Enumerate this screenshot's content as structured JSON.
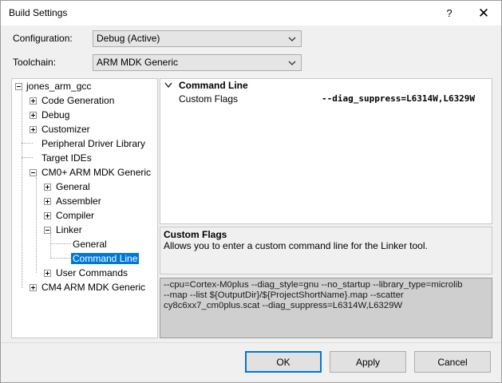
{
  "window": {
    "title": "Build Settings",
    "help_glyph": "?",
    "close_glyph": "✕"
  },
  "configuration": {
    "label": "Configuration:",
    "value": "Debug (Active)"
  },
  "toolchain": {
    "label": "Toolchain:",
    "value": "ARM MDK Generic"
  },
  "tree": {
    "root": "jones_arm_gcc",
    "items": [
      "Code Generation",
      "Debug",
      "Customizer",
      "Peripheral Driver Library",
      "Target IDEs",
      "CM0+ ARM MDK Generic",
      "General",
      "Assembler",
      "Compiler",
      "Linker",
      "General",
      "Command Line",
      "User Commands",
      "CM4 ARM MDK Generic"
    ]
  },
  "properties": {
    "category": "Command Line",
    "rows": [
      {
        "name": "Custom Flags",
        "value": "--diag_suppress=L6314W,L6329W"
      }
    ]
  },
  "description": {
    "title": "Custom Flags",
    "text": "Allows you to enter a custom command line for the Linker tool."
  },
  "command_line": {
    "line1": "--cpu=Cortex-M0plus --diag_style=gnu --no_startup --library_type=microlib",
    "line2": "--map --list ${OutputDir}/${ProjectShortName}.map --scatter",
    "line3": "cy8c6xx7_cm0plus.scat --diag_suppress=L6314W,L6329W"
  },
  "buttons": {
    "ok": "OK",
    "apply": "Apply",
    "cancel": "Cancel"
  },
  "colors": {
    "selection": "#0078d7",
    "accent_border": "#0078d7"
  }
}
